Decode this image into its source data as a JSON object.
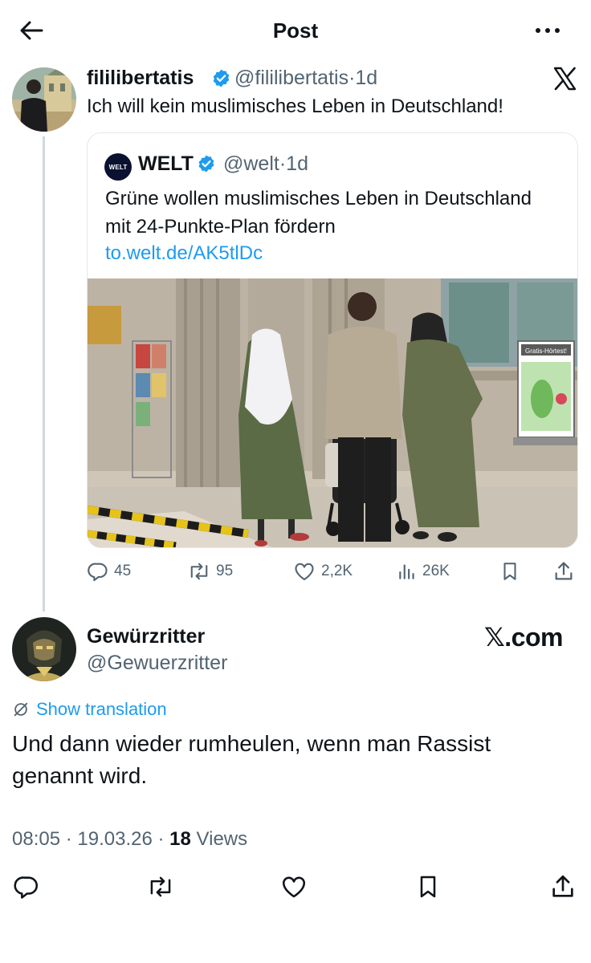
{
  "header": {
    "title": "Post",
    "back_icon": "arrow-left-icon",
    "more_icon": "more-horizontal-icon"
  },
  "post": {
    "author_name": "fililibertatis",
    "handle": "@fililibertatis",
    "time_sep": "·",
    "time": "1d",
    "verified": true,
    "text": "Ich will kein muslimisches Leben in Deutschland!",
    "platform_icon": "x-logo-icon",
    "quote": {
      "logo_text": "WELT",
      "author_name": "WELT",
      "handle": "@welt",
      "time_sep": "·",
      "time": "1d",
      "verified": true,
      "text": "Grüne wollen muslimisches Leben in Deutschland mit 24-Punkte-Plan fördern",
      "link": "to.welt.de/AK5tlDc",
      "image_sign_text": "Gratis-Hörtest!"
    },
    "stats": {
      "replies": "45",
      "reposts": "95",
      "likes": "2,2K",
      "views": "26K"
    }
  },
  "reply": {
    "author_name": "Gewürzritter",
    "handle": "@Gewuerzritter",
    "watermark": "𝕏.com",
    "show_translation": "Show translation",
    "text": "Und dann wieder rumheulen, wenn man Rassist genannt wird.",
    "time": "08:05",
    "sep1": "·",
    "date": "19.03.26",
    "sep2": "·",
    "views_count": "18",
    "views_label": "Views"
  },
  "colors": {
    "text": "#0f1419",
    "secondary": "#536471",
    "accent": "#1d9bf0",
    "border": "#cfd9de"
  }
}
